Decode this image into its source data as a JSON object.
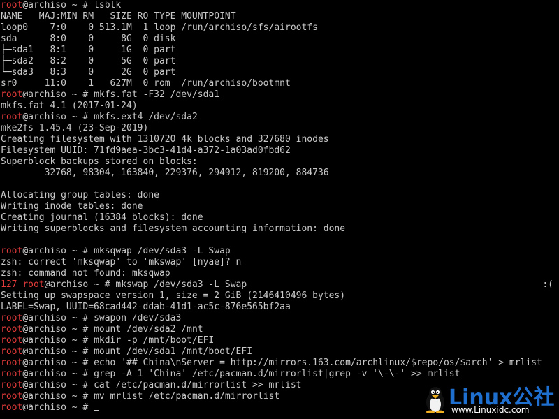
{
  "prompt": {
    "user": "root",
    "host_segment": "@archiso ~ # ",
    "exit_code": "127"
  },
  "colors": {
    "background": "#000000",
    "foreground": "#c8c8c8",
    "prompt_user": "#e43b3b",
    "watermark_blue": "#1e6fd0"
  },
  "lines": [
    {
      "type": "cmd",
      "text": "lsblk"
    },
    {
      "type": "out",
      "text": "NAME   MAJ:MIN RM   SIZE RO TYPE MOUNTPOINT"
    },
    {
      "type": "out",
      "text": "loop0    7:0    0 513.1M  1 loop /run/archiso/sfs/airootfs"
    },
    {
      "type": "out",
      "text": "sda      8:0    0     8G  0 disk"
    },
    {
      "type": "out",
      "text": "├─sda1   8:1    0     1G  0 part"
    },
    {
      "type": "out",
      "text": "├─sda2   8:2    0     5G  0 part"
    },
    {
      "type": "out",
      "text": "└─sda3   8:3    0     2G  0 part"
    },
    {
      "type": "out",
      "text": "sr0     11:0    1   627M  0 rom  /run/archiso/bootmnt"
    },
    {
      "type": "cmd",
      "text": "mkfs.fat -F32 /dev/sda1"
    },
    {
      "type": "out",
      "text": "mkfs.fat 4.1 (2017-01-24)"
    },
    {
      "type": "cmd",
      "text": "mkfs.ext4 /dev/sda2"
    },
    {
      "type": "out",
      "text": "mke2fs 1.45.4 (23-Sep-2019)"
    },
    {
      "type": "out",
      "text": "Creating filesystem with 1310720 4k blocks and 327680 inodes"
    },
    {
      "type": "out",
      "text": "Filesystem UUID: 71fd9aea-3bc3-41d4-a372-1a03ad0fbd62"
    },
    {
      "type": "out",
      "text": "Superblock backups stored on blocks:"
    },
    {
      "type": "out",
      "text": "        32768, 98304, 163840, 229376, 294912, 819200, 884736"
    },
    {
      "type": "out",
      "text": ""
    },
    {
      "type": "out",
      "text": "Allocating group tables: done"
    },
    {
      "type": "out",
      "text": "Writing inode tables: done"
    },
    {
      "type": "out",
      "text": "Creating journal (16384 blocks): done"
    },
    {
      "type": "out",
      "text": "Writing superblocks and filesystem accounting information: done"
    },
    {
      "type": "out",
      "text": ""
    },
    {
      "type": "cmd",
      "text": "mksqwap /dev/sda3 -L Swap"
    },
    {
      "type": "out",
      "text": "zsh: correct 'mksqwap' to 'mkswap' [nyae]? n"
    },
    {
      "type": "out",
      "text": "zsh: command not found: mksqwap"
    },
    {
      "type": "cmd_err",
      "text": "mkswap /dev/sda3 -L Swap",
      "right": ":("
    },
    {
      "type": "out",
      "text": "Setting up swapspace version 1, size = 2 GiB (2146410496 bytes)"
    },
    {
      "type": "out",
      "text": "LABEL=Swap, UUID=68cad442-ddab-41d1-ac5c-876e565bf2aa"
    },
    {
      "type": "cmd",
      "text": "swapon /dev/sda3"
    },
    {
      "type": "cmd",
      "text": "mount /dev/sda2 /mnt"
    },
    {
      "type": "cmd",
      "text": "mkdir -p /mnt/boot/EFI"
    },
    {
      "type": "cmd",
      "text": "mount /dev/sda1 /mnt/boot/EFI"
    },
    {
      "type": "cmd",
      "text": "echo '## China\\nServer = http://mirrors.163.com/archlinux/$repo/os/$arch' > mrlist"
    },
    {
      "type": "cmd",
      "text": "grep -A 1 'China' /etc/pacman.d/mirrorlist|grep -v '\\-\\-' >> mrlist"
    },
    {
      "type": "cmd",
      "text": "cat /etc/pacman.d/mirrorlist >> mrlist"
    },
    {
      "type": "cmd",
      "text": "mv mrlist /etc/pacman.d/mirrorlist"
    },
    {
      "type": "cmd_cursor",
      "text": ""
    }
  ],
  "watermark": {
    "title": "Linux公社",
    "url": "www.Linuxidc.com",
    "icon": "penguin-icon"
  }
}
